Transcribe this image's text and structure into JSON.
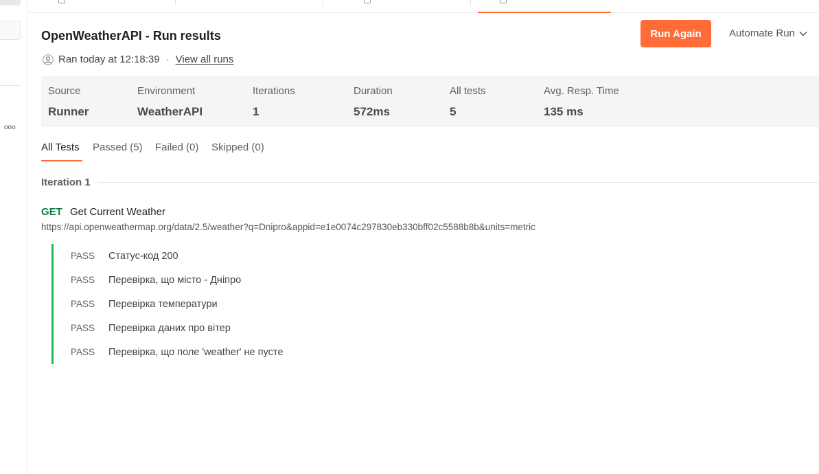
{
  "header": {
    "title": "OpenWeatherAPI - Run results",
    "run_again_label": "Run Again",
    "automate_label": "Automate Run",
    "ran_text": "Ran today at 12:18:39",
    "separator": "·",
    "view_all_runs_label": "View all runs"
  },
  "sidebar": {
    "more_label": "ooo"
  },
  "summary": {
    "source": {
      "label": "Source",
      "value": "Runner"
    },
    "environment": {
      "label": "Environment",
      "value": "WeatherAPI"
    },
    "iterations": {
      "label": "Iterations",
      "value": "1"
    },
    "duration": {
      "label": "Duration",
      "value": "572ms"
    },
    "all_tests": {
      "label": "All tests",
      "value": "5"
    },
    "avg_resp": {
      "label": "Avg. Resp. Time",
      "value": "135 ms"
    }
  },
  "filters": {
    "all": "All Tests",
    "passed": "Passed (5)",
    "failed": "Failed (0)",
    "skipped": "Skipped (0)"
  },
  "iteration": {
    "label": "Iteration 1"
  },
  "request": {
    "method": "GET",
    "name": "Get Current Weather",
    "url": "https://api.openweathermap.org/data/2.5/weather?q=Dnipro&appid=e1e0074c297830eb330bff02c5588b8b&units=metric"
  },
  "tests": [
    {
      "status": "PASS",
      "name": "Статус-код 200"
    },
    {
      "status": "PASS",
      "name": "Перевірка, що місто - Дніпро"
    },
    {
      "status": "PASS",
      "name": "Перевірка температури"
    },
    {
      "status": "PASS",
      "name": "Перевірка даних про вітер"
    },
    {
      "status": "PASS",
      "name": "Перевірка, що поле 'weather' не пусте"
    }
  ],
  "colors": {
    "accent": "#ff6c37",
    "method_get": "#0a7d3e",
    "pass_bar": "#1db954"
  }
}
